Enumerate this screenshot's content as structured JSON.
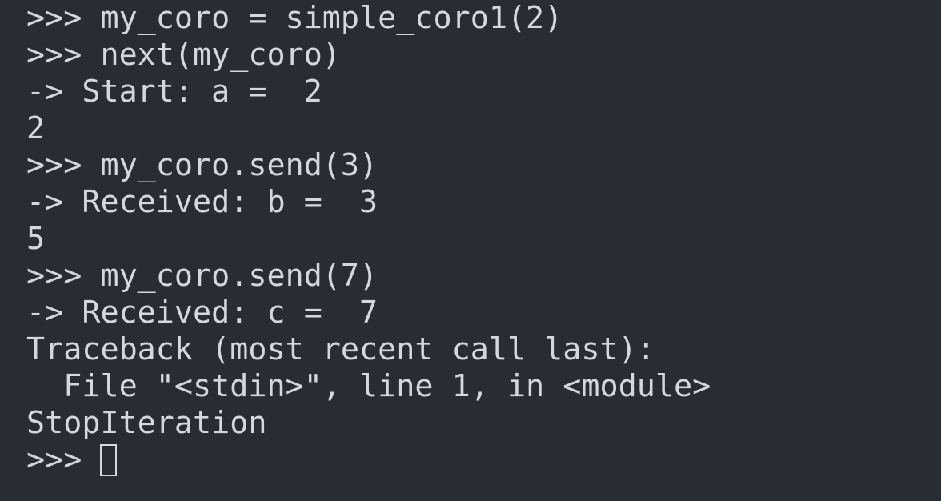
{
  "terminal": {
    "lines": [
      ">>> my_coro = simple_coro1(2)",
      ">>> next(my_coro)",
      "-> Start: a =  2",
      "2",
      ">>> my_coro.send(3)",
      "-> Received: b =  3",
      "5",
      ">>> my_coro.send(7)",
      "-> Received: c =  7",
      "Traceback (most recent call last):",
      "  File \"<stdin>\", line 1, in <module>",
      "StopIteration"
    ],
    "prompt": ">>> ",
    "colors": {
      "background": "#282c34",
      "text": "#d4d7dd"
    }
  }
}
